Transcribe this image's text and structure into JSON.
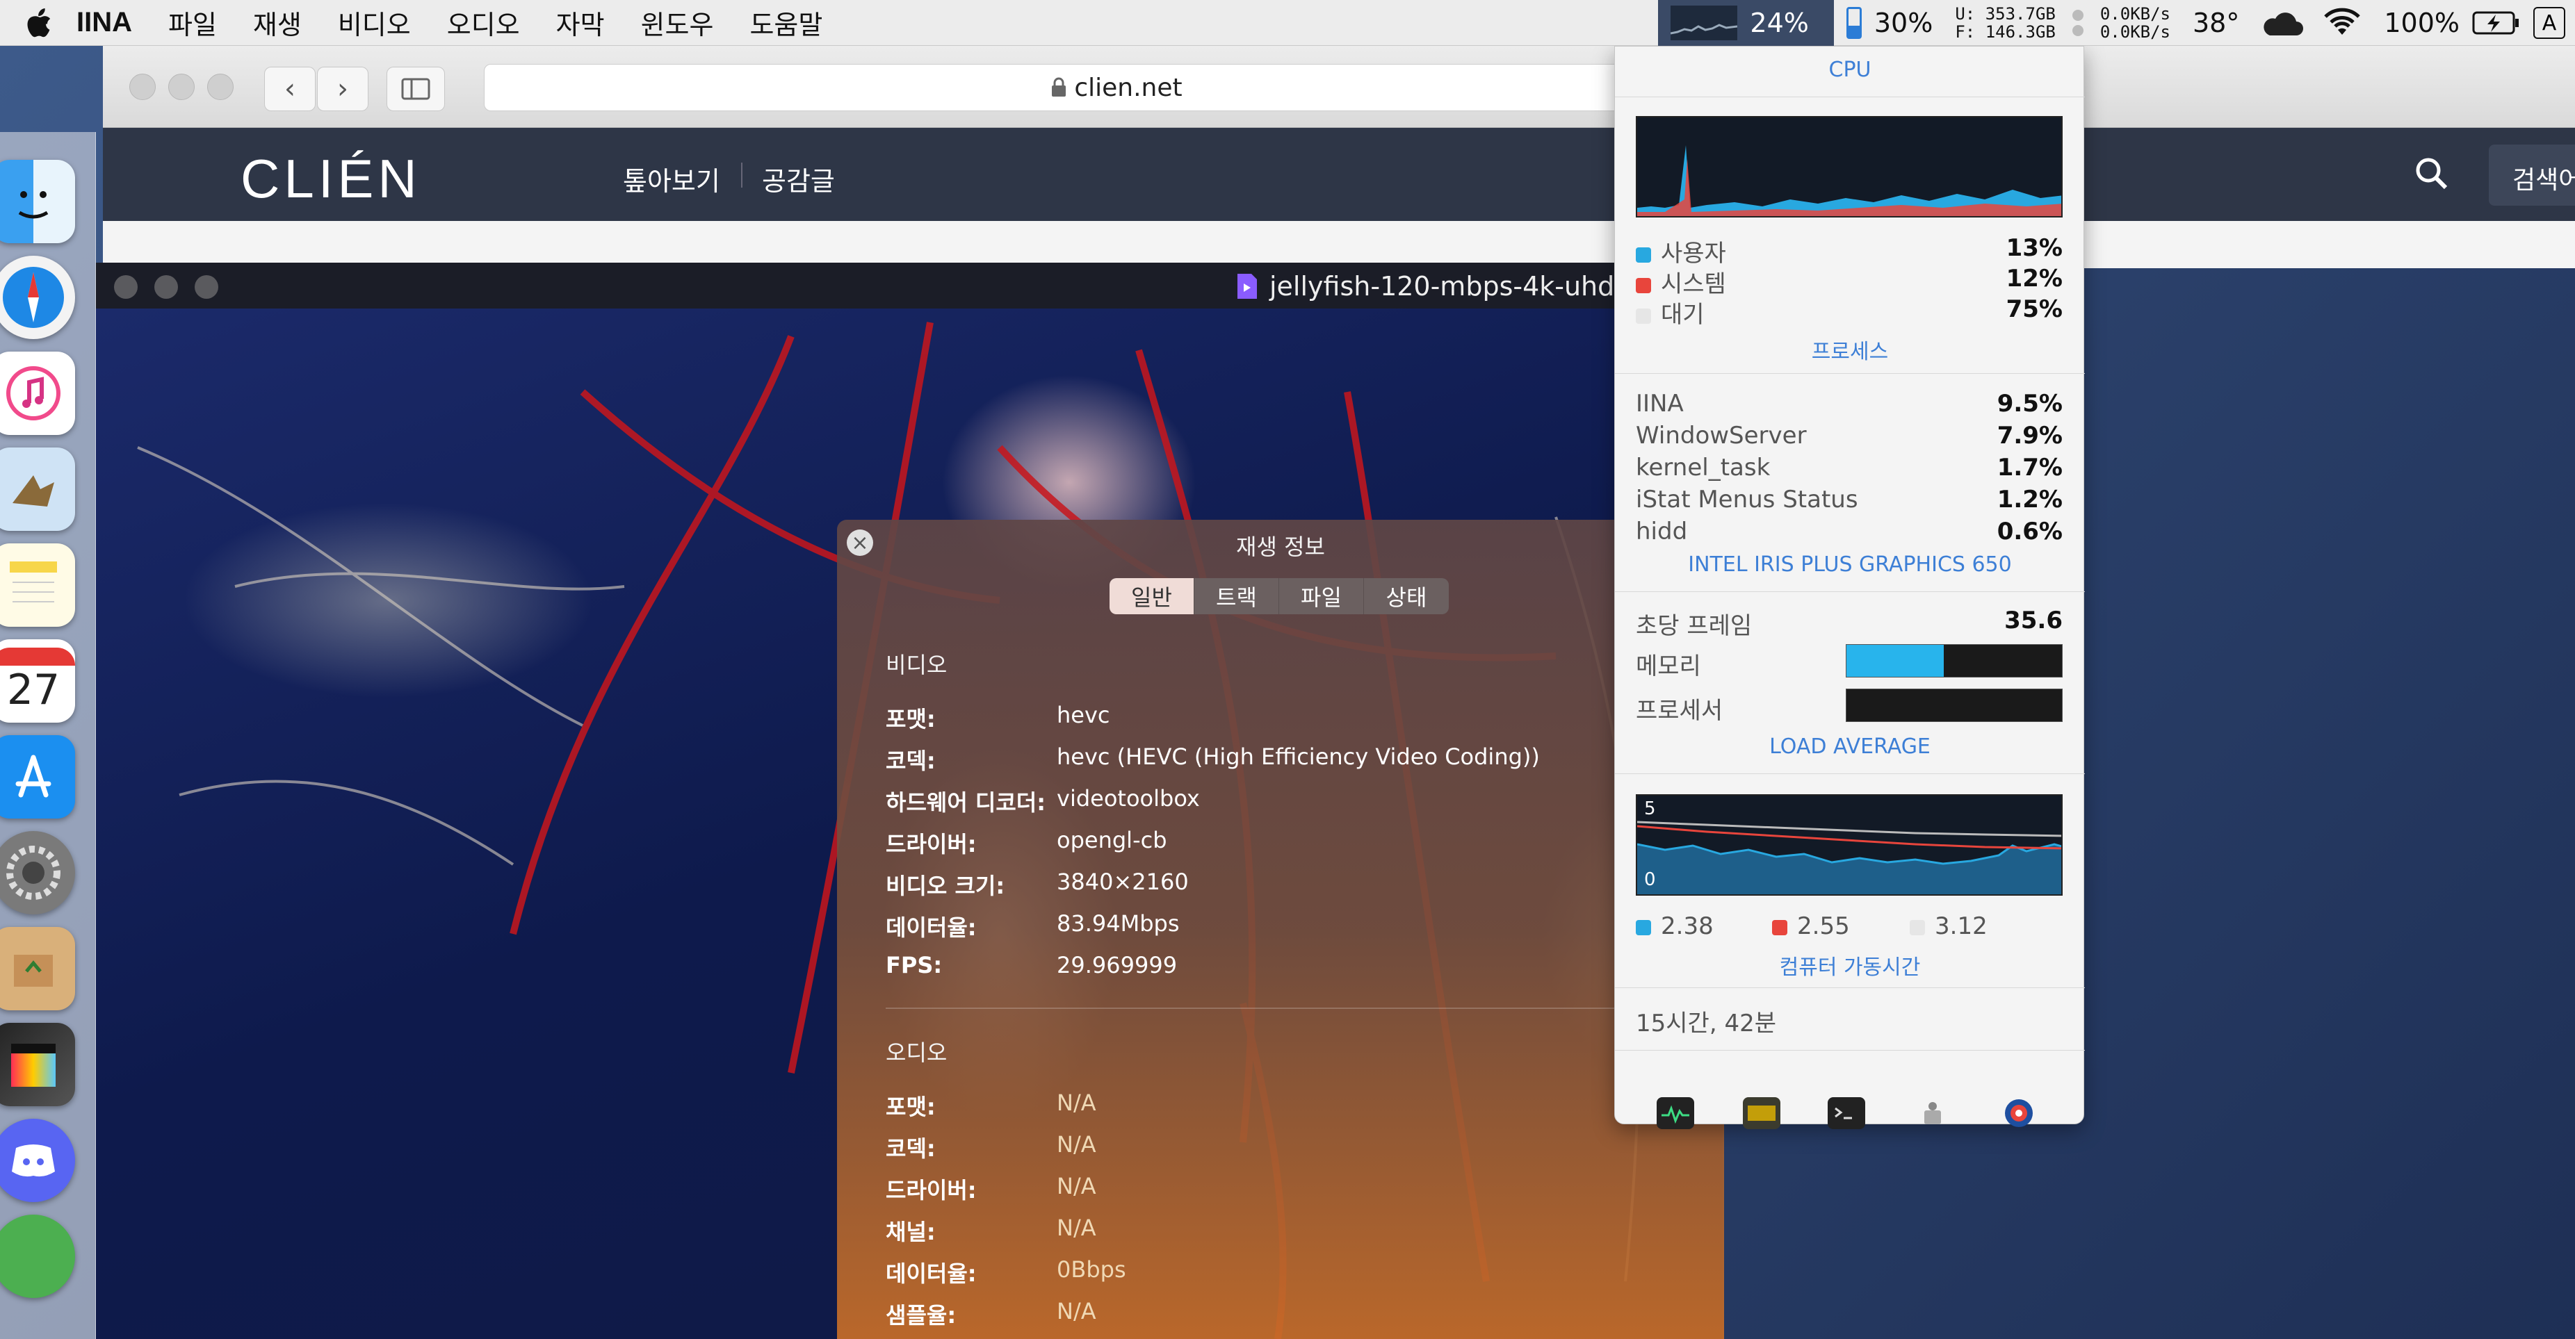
{
  "menubar": {
    "app": "IINA",
    "items": [
      "파일",
      "재생",
      "비디오",
      "오디오",
      "자막",
      "윈도우",
      "도움말"
    ],
    "cpu_percent": "24%",
    "memory_percent": "30%",
    "disk_used": "U: 353.7GB",
    "disk_free": "F: 146.3GB",
    "net_up": "0.0KB/s",
    "net_down": "0.0KB/s",
    "temperature": "38°",
    "battery": "100%",
    "input_source": "A"
  },
  "safari": {
    "url": "clien.net",
    "logo": "CLIÉN",
    "nav": [
      "톺아보기",
      "공감글"
    ],
    "search_placeholder": "검색어"
  },
  "iina": {
    "title": "jellyfish-120-mbps-4k-uhd"
  },
  "info_panel": {
    "title": "재생 정보",
    "tabs": [
      "일반",
      "트랙",
      "파일",
      "상태"
    ],
    "active_tab": "일반",
    "video_section": "비디오",
    "video_rows": [
      {
        "key": "포맷:",
        "value": "hevc"
      },
      {
        "key": "코덱:",
        "value": "hevc (HEVC (High Efficiency Video Coding))"
      },
      {
        "key": "하드웨어 디코더:",
        "value": "videotoolbox"
      },
      {
        "key": "드라이버:",
        "value": "opengl-cb"
      },
      {
        "key": "비디오 크기:",
        "value": "3840×2160"
      },
      {
        "key": "데이터율:",
        "value": "83.94Mbps"
      },
      {
        "key": "FPS:",
        "value": "29.969999"
      }
    ],
    "audio_section": "오디오",
    "audio_rows": [
      {
        "key": "포맷:",
        "value": "N/A"
      },
      {
        "key": "코덱:",
        "value": "N/A"
      },
      {
        "key": "드라이버:",
        "value": "N/A"
      },
      {
        "key": "채널:",
        "value": "N/A"
      },
      {
        "key": "데이터율:",
        "value": "0Bbps"
      },
      {
        "key": "샘플율:",
        "value": "N/A"
      }
    ]
  },
  "istat": {
    "cpu_header": "CPU",
    "cpu_user_label": "사용자",
    "cpu_user": "13%",
    "cpu_system_label": "시스템",
    "cpu_system": "12%",
    "cpu_idle_label": "대기",
    "cpu_idle": "75%",
    "process_header": "프로세스",
    "processes": [
      {
        "name": "IINA",
        "value": "9.5%"
      },
      {
        "name": "WindowServer",
        "value": "7.9%"
      },
      {
        "name": "kernel_task",
        "value": "1.7%"
      },
      {
        "name": "iStat Menus Status",
        "value": "1.2%"
      },
      {
        "name": "hidd",
        "value": "0.6%"
      }
    ],
    "gpu_header": "INTEL IRIS PLUS GRAPHICS 650",
    "fps_label": "초당 프레임",
    "fps_value": "35.6",
    "memory_label": "메모리",
    "memory_fraction": 0.45,
    "processor_label": "프로세서",
    "processor_fraction": 0.0,
    "load_header": "LOAD AVERAGE",
    "load_max": "5",
    "load_min": "0",
    "load_1": "2.38",
    "load_5": "2.55",
    "load_15": "3.12",
    "uptime_header": "컴퓨터 가동시간",
    "uptime": "15시간, 42분",
    "colors": {
      "user": "#28a8e0",
      "system": "#e8453c",
      "idle": "#e6e6e6",
      "accent": "#3d7fd6"
    }
  }
}
